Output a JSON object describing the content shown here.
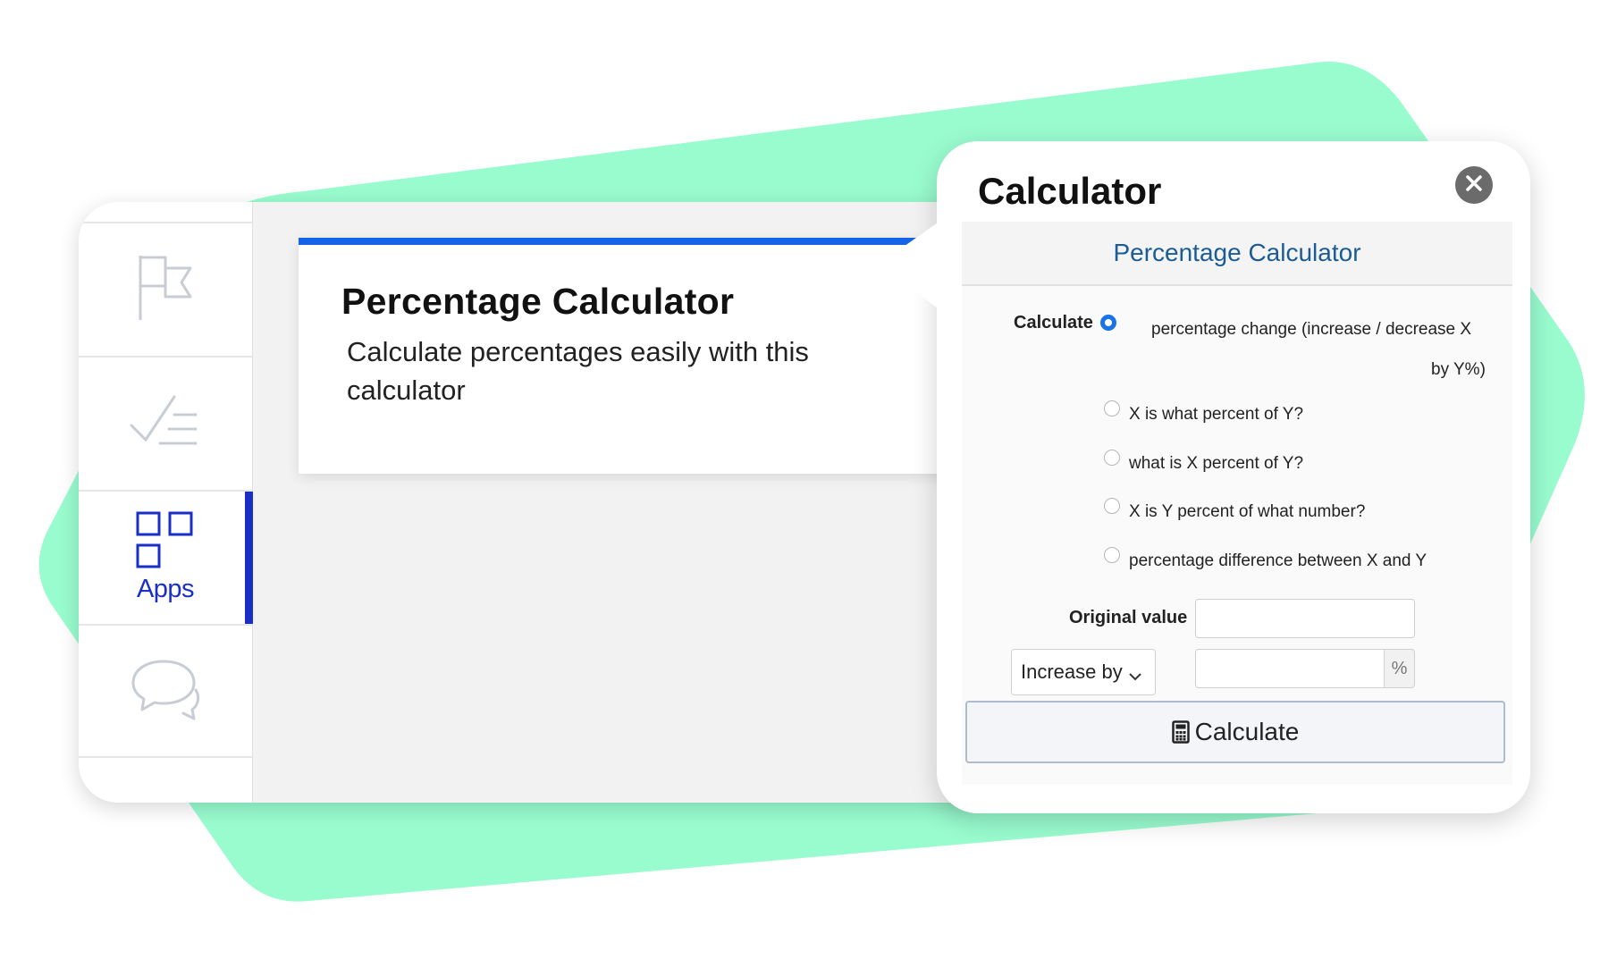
{
  "sidebar": {
    "items": [
      {
        "icon": "flag-icon",
        "label": ""
      },
      {
        "icon": "checklist-icon",
        "label": ""
      },
      {
        "icon": "apps-grid-icon",
        "label": "Apps",
        "active": true
      },
      {
        "icon": "chat-bubbles-icon",
        "label": ""
      }
    ]
  },
  "info_card": {
    "title": "Percentage Calculator",
    "description": "Calculate percentages easily with this calculator"
  },
  "calculator": {
    "title": "Calculator",
    "close_icon": "close-icon",
    "subtitle": "Percentage Calculator",
    "calculate_label": "Calculate",
    "options": [
      {
        "label": "percentage change (increase / decrease X",
        "label_cont": "by Y%)",
        "checked": true
      },
      {
        "label": "X is what percent of Y?",
        "checked": false
      },
      {
        "label": "what is X percent of Y?",
        "checked": false
      },
      {
        "label": "X is Y percent of what number?",
        "checked": false
      },
      {
        "label": "percentage difference between X and Y",
        "checked": false
      }
    ],
    "original_value_label": "Original value",
    "original_value": "",
    "mode_select": {
      "selected": "Increase by"
    },
    "percent_value": "",
    "percent_symbol": "%",
    "button_label": "Calculate",
    "button_icon": "calculator-icon"
  },
  "colors": {
    "accent_blue": "#1a2fc5",
    "card_top_border": "#1563e6",
    "background_shape": "#99fccf",
    "radio_checked": "#1a73e8",
    "subtitle": "#1a5c95"
  }
}
